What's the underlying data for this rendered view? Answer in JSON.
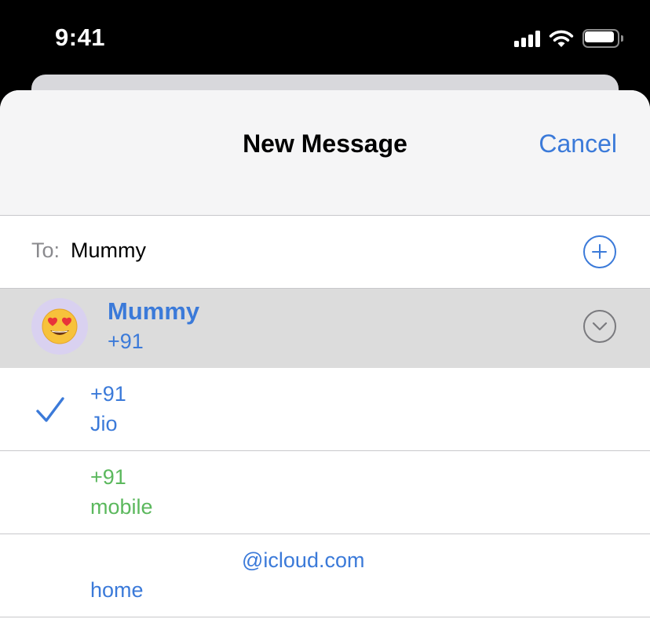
{
  "status_bar": {
    "time": "9:41",
    "icons": [
      "cellular-signal-icon",
      "wifi-icon",
      "battery-icon"
    ]
  },
  "sheet": {
    "title": "New Message",
    "cancel_label": "Cancel"
  },
  "to_field": {
    "label": "To:",
    "value": "Mummy",
    "add_icon": "plus-circle-icon"
  },
  "contact": {
    "avatar_emoji": "😍",
    "name": "Mummy",
    "number": "+91",
    "expand_icon": "chevron-down-circle-icon"
  },
  "options": [
    {
      "line1": "+91",
      "line2": "Jio",
      "selected": true,
      "color": "#3b7ad9"
    },
    {
      "line1": "+91",
      "line2": "mobile",
      "selected": false,
      "color": "#5bb85d"
    },
    {
      "line1": "@icloud.com",
      "line2": "home",
      "selected": false,
      "color": "#3b7ad9"
    }
  ],
  "colors": {
    "accent": "#3b7ad9",
    "sms_green": "#5bb85d",
    "selected_row_bg": "#dcdcdc",
    "header_bg": "#f5f5f6"
  }
}
